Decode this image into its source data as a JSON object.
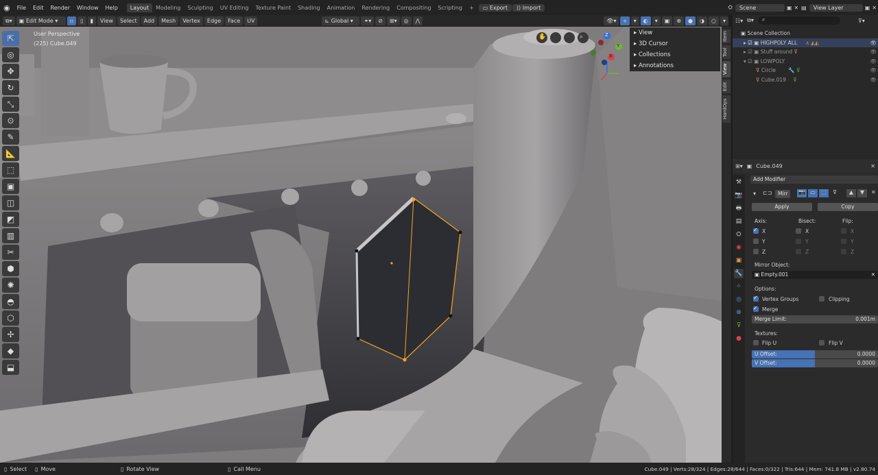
{
  "topbar": {
    "menus": [
      "File",
      "Edit",
      "Render",
      "Window",
      "Help"
    ],
    "workspaces": [
      "Layout",
      "Modeling",
      "Sculpting",
      "UV Editing",
      "Texture Paint",
      "Shading",
      "Animation",
      "Rendering",
      "Compositing",
      "Scripting"
    ],
    "active_workspace": "Layout",
    "plus": "+",
    "export_label": "Export",
    "import_label": "Import",
    "scene_label": "Scene",
    "view_layer_label": "View Layer"
  },
  "viewport_header": {
    "mode": "Edit Mode",
    "menus": [
      "View",
      "Select",
      "Add",
      "Mesh",
      "Vertex",
      "Edge",
      "Face",
      "UV"
    ],
    "orientation": "Global"
  },
  "viewport": {
    "perspective": "User Perspective",
    "object_info": "(225) Cube.049",
    "gizmo_axes": [
      "Z",
      "Y",
      "X"
    ]
  },
  "nav_panel": {
    "items": [
      "View",
      "3D Cursor",
      "Collections",
      "Annotations"
    ]
  },
  "side_tabs": [
    "Item",
    "Tool",
    "View",
    "Edit",
    "HardOps"
  ],
  "outliner": {
    "search_placeholder": "",
    "rows": [
      {
        "label": "Scene Collection"
      },
      {
        "label": "HIGHPOLY ALL"
      },
      {
        "label": "Stuff around"
      },
      {
        "label": "LOWPOLY"
      },
      {
        "label": "Circle"
      },
      {
        "label": "Cube.019"
      }
    ]
  },
  "properties": {
    "object_name": "Cube.049",
    "add_modifier": "Add Modifier",
    "modifier_name": "Mirr",
    "apply": "Apply",
    "copy": "Copy",
    "axis_label": "Axis:",
    "bisect_label": "Bisect:",
    "flip_label": "Flip:",
    "axes": [
      "X",
      "Y",
      "Z"
    ],
    "mirror_object_label": "Mirror Object:",
    "mirror_object": "Empty.001",
    "options_label": "Options:",
    "vertex_groups": "Vertex Groups",
    "clipping": "Clipping",
    "merge": "Merge",
    "merge_limit_label": "Merge Limit:",
    "merge_limit_value": "0.001m",
    "textures_label": "Textures:",
    "flip_u": "Flip U",
    "flip_v": "Flip V",
    "u_offset_label": "U Offset:",
    "u_offset_value": "0.0000",
    "v_offset_label": "V Offset:",
    "v_offset_value": "0.0000"
  },
  "status": {
    "select": "Select",
    "move": "Move",
    "rotate_view": "Rotate View",
    "call_menu": "Call Menu",
    "stats": "Cube.049 | Verts:28/324 | Edges:28/644 | Faces:0/322 | Tris:644 | Mem: 741.8 MB | v2.80.74"
  },
  "colors": {
    "accent": "#4772b3",
    "selection": "#f5a623",
    "background": "#232323"
  }
}
